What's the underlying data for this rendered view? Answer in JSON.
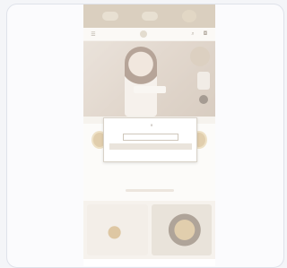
{
  "modal": {
    "title": "",
    "body": "",
    "reject_label": "",
    "accept_label": "",
    "settings_label": ""
  },
  "colors": {
    "promo_bar": "#bca88b",
    "hero": "#c8b5a2",
    "modal_accept": "#eae4dc",
    "gold": "#c9a66b"
  },
  "icons": [
    "menu-icon",
    "search-icon",
    "cart-icon",
    "close-icon"
  ]
}
